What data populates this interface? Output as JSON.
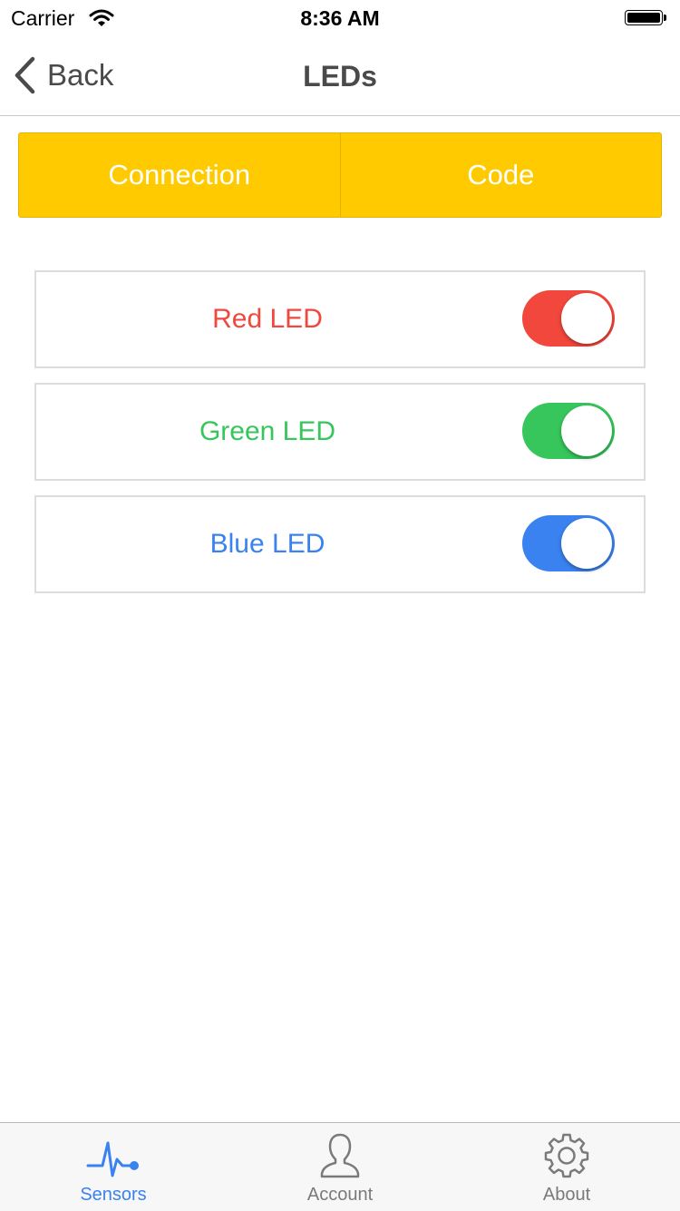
{
  "status_bar": {
    "carrier": "Carrier",
    "time": "8:36 AM",
    "icons": [
      "wifi-icon",
      "battery-icon"
    ]
  },
  "nav": {
    "back_label": "Back",
    "title": "LEDs",
    "back_icon": "chevron-left-icon"
  },
  "segments": [
    {
      "label": "Connection"
    },
    {
      "label": "Code"
    }
  ],
  "segment_color": "#ffcb00",
  "leds": [
    {
      "label": "Red LED",
      "color": "#f2473c",
      "on": true
    },
    {
      "label": "Green LED",
      "color": "#36c65b",
      "on": true
    },
    {
      "label": "Blue LED",
      "color": "#3a82f0",
      "on": true
    }
  ],
  "tabs": [
    {
      "label": "Sensors",
      "icon": "pulse-icon",
      "active": true
    },
    {
      "label": "Account",
      "icon": "person-icon",
      "active": false
    },
    {
      "label": "About",
      "icon": "gear-icon",
      "active": false
    }
  ],
  "accent_color": "#3a82f0"
}
